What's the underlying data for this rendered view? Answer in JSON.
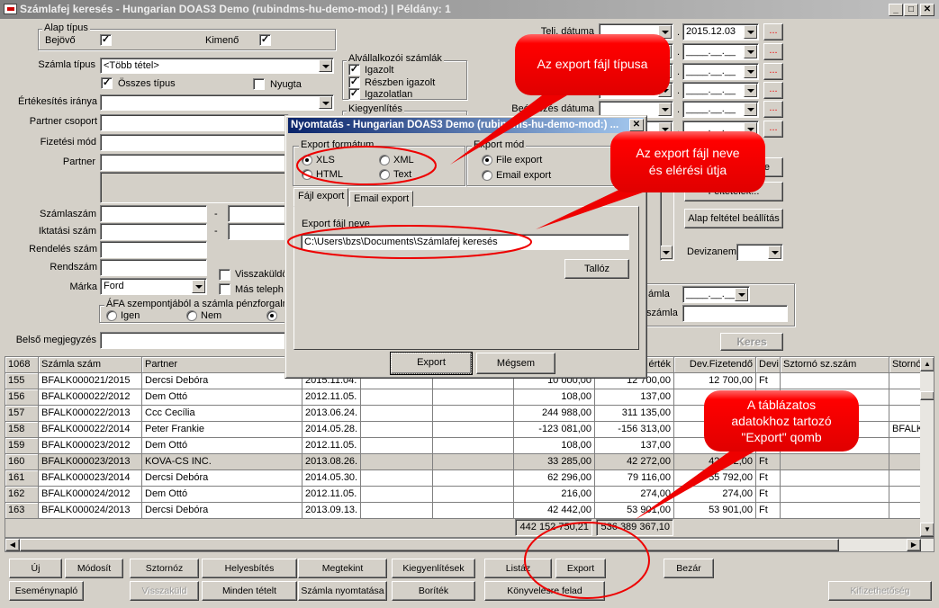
{
  "window": {
    "title": "Számlafej keresés - Hungarian DOAS3 Demo (rubindms-hu-demo-mod:) | Példány: 1",
    "minimize": "_",
    "maximize": "□",
    "close": "✕"
  },
  "form": {
    "alap_tipus": {
      "title": "Alap típus",
      "bejovo": "Bejövő",
      "bejovo_checked": true,
      "kimeno": "Kimenő",
      "kimeno_checked": true
    },
    "szamla_tipus": {
      "label": "Számla típus",
      "value": "<Több tétel>"
    },
    "osszes_tipus": {
      "label": "Összes típus",
      "checked": true
    },
    "nyugta": {
      "label": "Nyugta",
      "checked": false
    },
    "ertekesites_iranya": {
      "label": "Értékesítés iránya",
      "value": ""
    },
    "partner_csoport": "Partner csoport",
    "fizetesi_mod": "Fizetési mód",
    "partner": "Partner",
    "szamlaszam": "Számlaszám",
    "iktatasi_szam": "Iktatási szám",
    "rendeles_szam": "Rendelés szám",
    "rendszam": "Rendszám",
    "marka": {
      "label": "Márka",
      "value": "Ford"
    },
    "dash": "-",
    "visszakuldo": "Visszaküldö",
    "mas_telep": "Más teleph",
    "afa": {
      "title": "ÁFA szempontjából a számla pénzforgalmi",
      "igen": "Igen",
      "nem": "Nem"
    },
    "belso_megjegyzes": "Belső megjegyzés",
    "alvallalkozoi": {
      "title": "Alvállalkozói számlák",
      "items": [
        {
          "label": "Igazolt",
          "checked": true
        },
        {
          "label": "Részben igazolt",
          "checked": true
        },
        {
          "label": "Igazolatlan",
          "checked": true
        }
      ]
    },
    "kiegyenlites": "Kiegyenlítés",
    "telj_datuma": "Telj. dátuma",
    "beerkezes_datuma": "Beérkezés dátuma",
    "date_to_first": "2015.12.03",
    "date_empty": "____.__.__",
    "dot": ".",
    "ellipsis_btn": "...",
    "felteletek_partial": "e",
    "felteletek": "Feltételek...",
    "alap_feltetel": "Alap feltétel beállítás",
    "devizanem": "Devizanem",
    "szamla_partial": "ámla",
    "szamla_partial2": "számla",
    "keres": "Keres"
  },
  "grid": {
    "count": "1068",
    "columns": [
      "Számla szám",
      "Partner",
      "",
      "",
      "",
      "",
      "érték",
      "Dev.Fizetendő",
      "Devi",
      "Sztornó sz.szám",
      "Stornó"
    ],
    "rows": [
      {
        "n": "155",
        "szam": "BFALK000021/2015",
        "partner": "Dercsi Debóra",
        "date": "2015.11.04.",
        "v1": "10 000,00",
        "v2": "12 700,00",
        "dev": "12 700,00",
        "devi": "Ft",
        "storno": ""
      },
      {
        "n": "156",
        "szam": "BFALK000022/2012",
        "partner": "Dem Ottó",
        "date": "2012.11.05.",
        "v1": "108,00",
        "v2": "137,00",
        "dev": "",
        "devi": "",
        "storno": ""
      },
      {
        "n": "157",
        "szam": "BFALK000022/2013",
        "partner": "Ccc Cecília",
        "date": "2013.06.24.",
        "v1": "244 988,00",
        "v2": "311 135,00",
        "dev": "",
        "devi": "",
        "storno": ""
      },
      {
        "n": "158",
        "szam": "BFALK000022/2014",
        "partner": "Peter Frankie",
        "date": "2014.05.28.",
        "v1": "-123 081,00",
        "v2": "-156 313,00",
        "dev": "",
        "devi": "",
        "storno": "BFALK"
      },
      {
        "n": "159",
        "szam": "BFALK000023/2012",
        "partner": "Dem Ottó",
        "date": "2012.11.05.",
        "v1": "108,00",
        "v2": "137,00",
        "dev": "",
        "devi": "",
        "storno": ""
      },
      {
        "n": "160",
        "szam": "BFALK000023/2013",
        "partner": "KOVA-CS INC.",
        "date": "2013.08.26.",
        "v1": "33 285,00",
        "v2": "42 272,00",
        "dev": "42 272,00",
        "devi": "Ft",
        "storno": "",
        "selected": true
      },
      {
        "n": "161",
        "szam": "BFALK000023/2014",
        "partner": "Dercsi Debóra",
        "date": "2014.05.30.",
        "v1": "62 296,00",
        "v2": "79 116,00",
        "dev": "55 792,00",
        "devi": "Ft",
        "storno": ""
      },
      {
        "n": "162",
        "szam": "BFALK000024/2012",
        "partner": "Dem Ottó",
        "date": "2012.11.05.",
        "v1": "216,00",
        "v2": "274,00",
        "dev": "274,00",
        "devi": "Ft",
        "storno": ""
      },
      {
        "n": "163",
        "szam": "BFALK000024/2013",
        "partner": "Dercsi Debóra",
        "date": "2013.09.13.",
        "v1": "42 442,00",
        "v2": "53 901,00",
        "dev": "53 901,00",
        "devi": "Ft",
        "storno": ""
      }
    ],
    "totals": [
      "442 152 750,21",
      "536 389 367,10"
    ]
  },
  "buttons": {
    "row1": [
      "Új",
      "Módosít",
      "Sztornóz",
      "Helyesbítés",
      "Megtekint",
      "Kiegyenlítések",
      "Listáz",
      "Export",
      "Bezár"
    ],
    "row2": [
      "Eseménynapló",
      "Visszaküld",
      "Minden tételt",
      "Számla nyomtatása",
      "Boríték",
      "Könyvelésre felad",
      "Kifizethetőség"
    ]
  },
  "dialog": {
    "title": "Nyomtatás - Hungarian DOAS3 Demo (rubindms-hu-demo-mod:) ...",
    "close": "✕",
    "format": {
      "title": "Export formátum",
      "options": [
        "XLS",
        "XML",
        "HTML",
        "Text"
      ],
      "selected": "XLS"
    },
    "mode": {
      "title": "Export mód",
      "options": [
        "File export",
        "Email export"
      ],
      "selected": "File export"
    },
    "tabs": [
      "Fájl export",
      "Email export"
    ],
    "active_tab": "Fájl export",
    "file_label": "Export fájl neve",
    "file_value": "C:\\Users\\bzs\\Documents\\Számlafej keresés",
    "browse": "Tallóz",
    "export": "Export",
    "cancel": "Mégsem"
  },
  "callouts": [
    "Az export fájl típusa",
    "Az export fájl neve",
    "és elérési útja",
    "A táblázatos",
    "adatokhoz tartozó",
    "\"Export\" qomb"
  ],
  "colors": {
    "callout": "#ff0000",
    "dialog_title": "#0a246a",
    "window_bg": "#d4d0c8",
    "accelerator": "#ff0000"
  }
}
